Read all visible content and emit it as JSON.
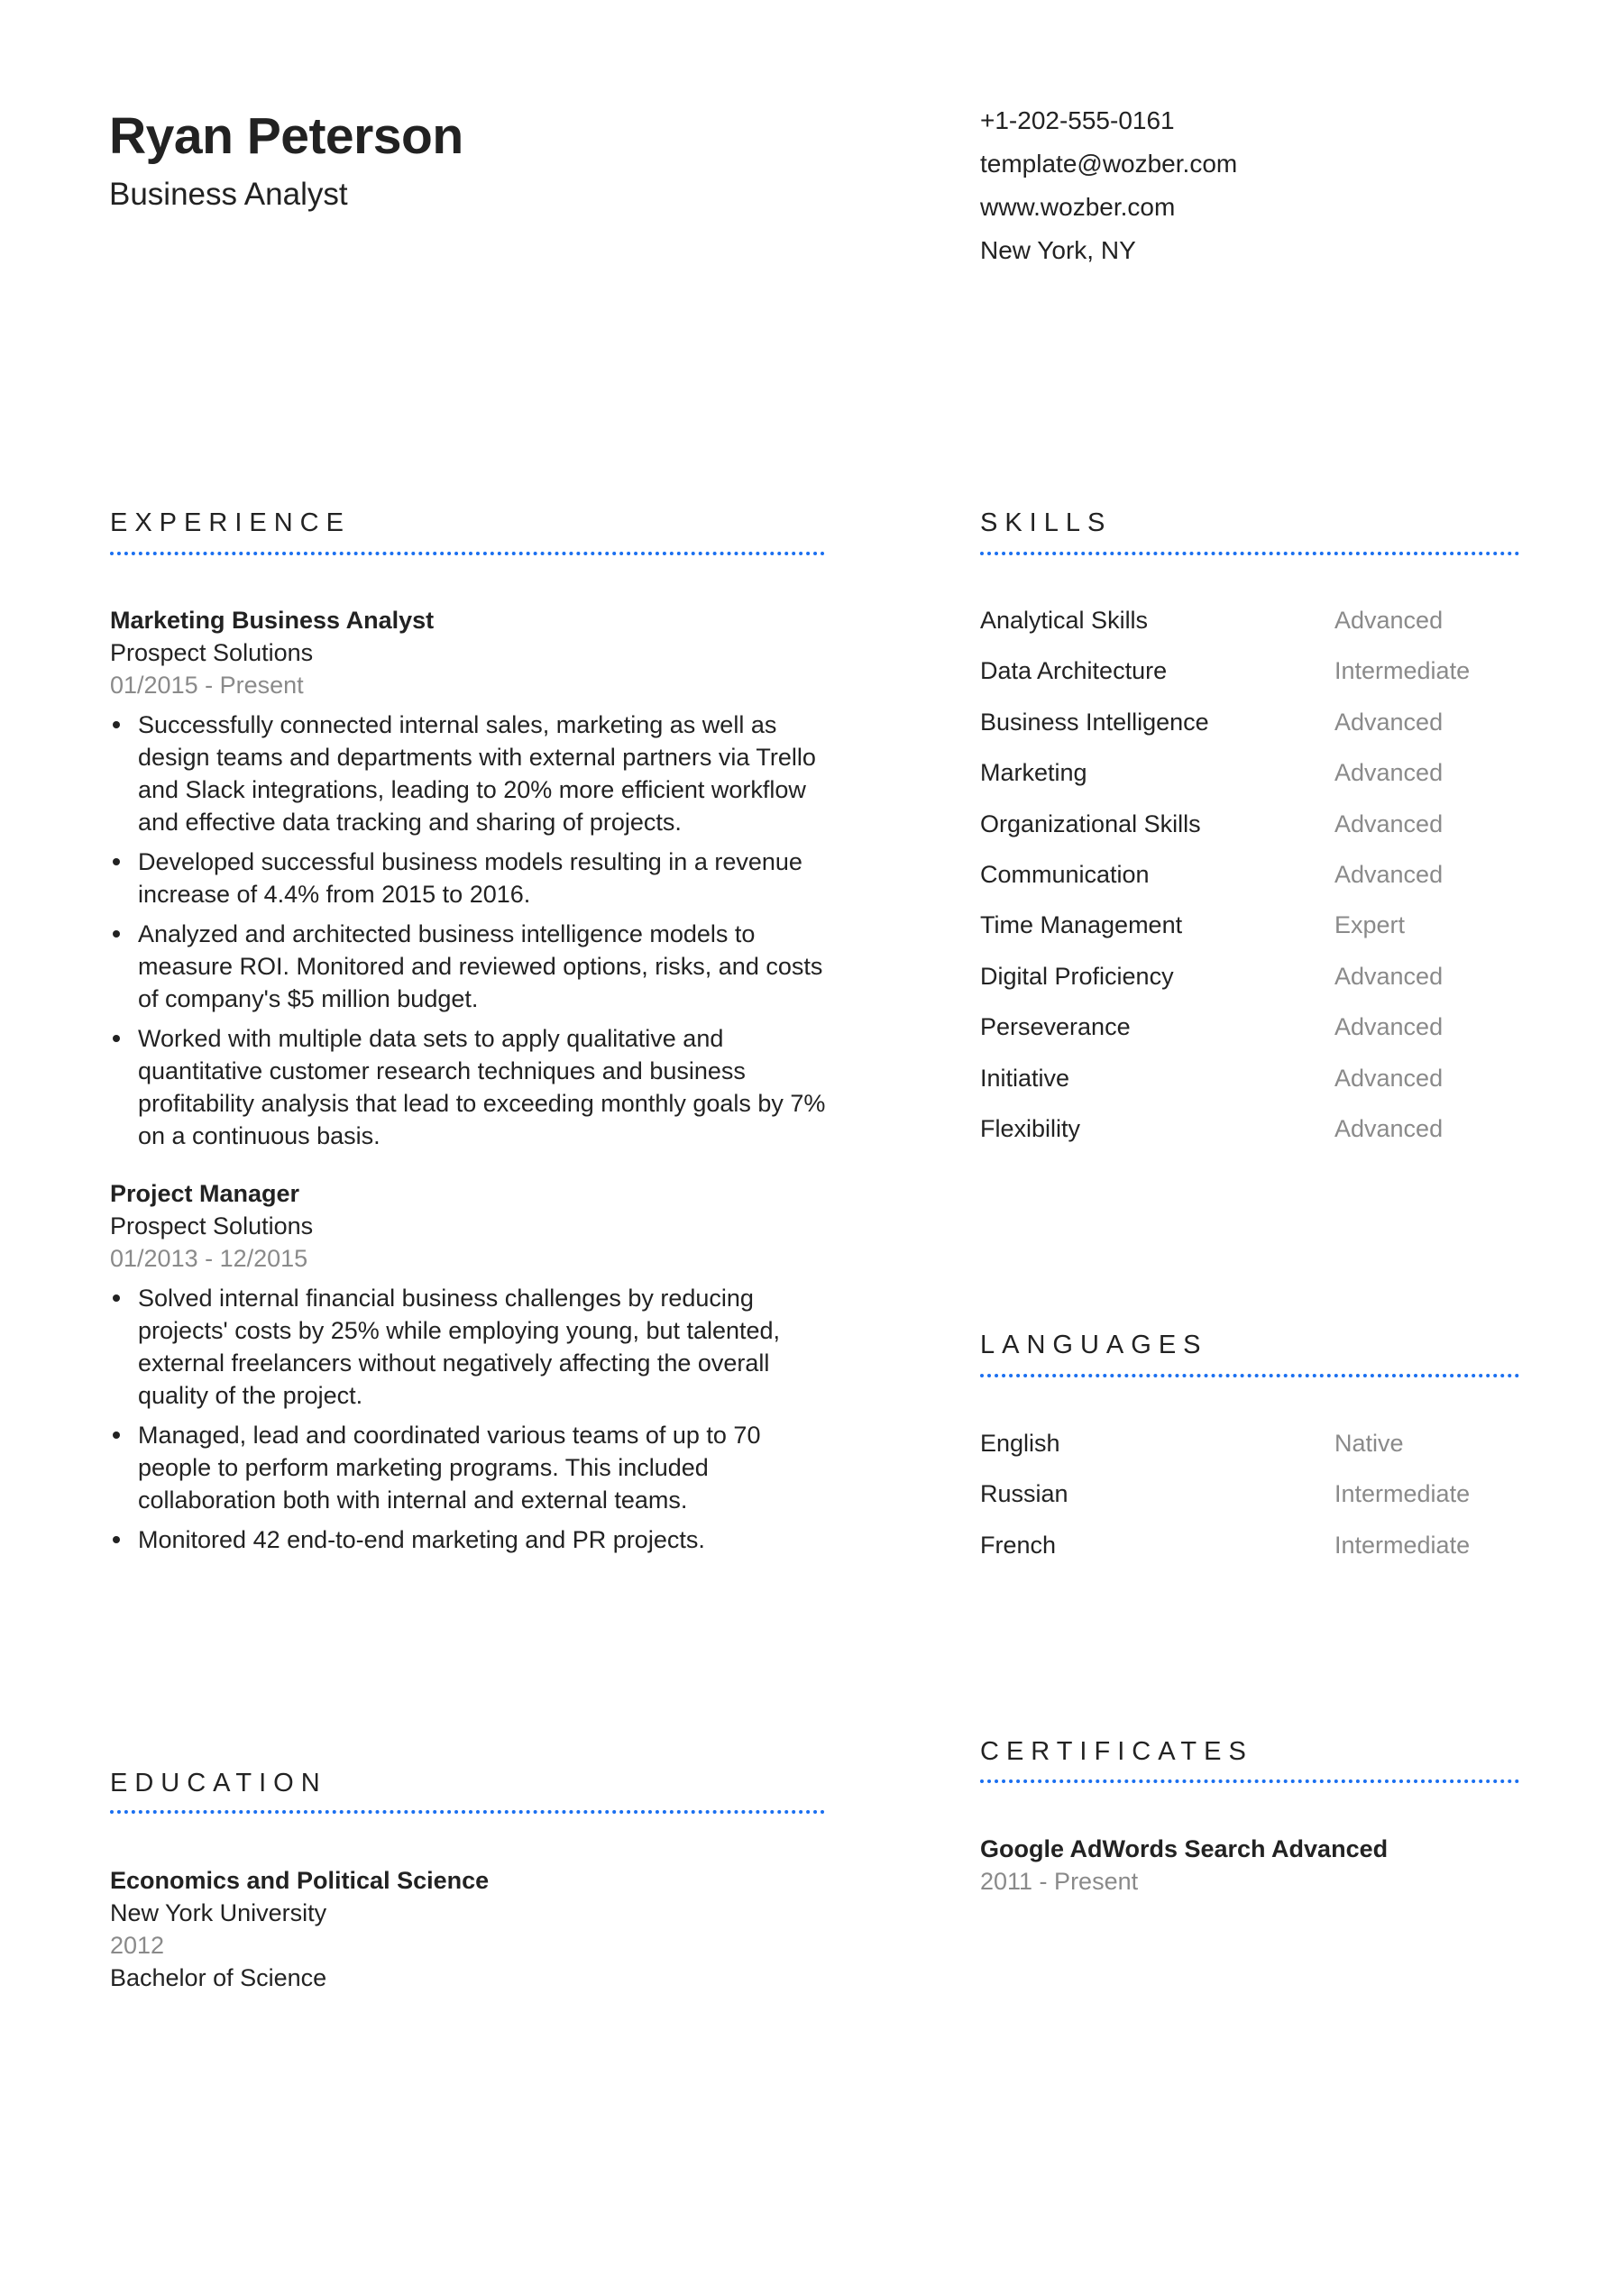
{
  "header": {
    "name": "Ryan Peterson",
    "title": "Business Analyst",
    "contact": {
      "phone": "+1-202-555-0161",
      "email": "template@wozber.com",
      "website": "www.wozber.com",
      "location": "New York, NY"
    }
  },
  "theme": {
    "accent_color": "#1a6ff0",
    "text_color": "#222222",
    "muted_color": "#8a8a8a"
  },
  "experience": {
    "heading": "EXPERIENCE",
    "jobs": [
      {
        "title": "Marketing Business Analyst",
        "company": "Prospect Solutions",
        "dates": "01/2015 - Present",
        "bullets": [
          "Successfully connected internal sales, marketing as well as design teams and departments with external partners via Trello and Slack integrations, leading to 20% more efficient workflow and effective data tracking and sharing of projects.",
          "Developed successful business models resulting in a revenue increase of 4.4% from 2015 to 2016.",
          "Analyzed and architected business intelligence models to measure ROI. Monitored and reviewed options, risks, and costs of company's $5 million budget.",
          "Worked with multiple data sets to apply qualitative and quantitative customer research techniques and business profitability analysis that lead to exceeding monthly goals by 7% on a continuous basis."
        ]
      },
      {
        "title": "Project Manager",
        "company": "Prospect Solutions",
        "dates": "01/2013 - 12/2015",
        "bullets": [
          "Solved internal financial business challenges by reducing projects' costs by 25% while employing young, but talented, external freelancers without negatively affecting the overall quality of the project.",
          "Managed, lead and coordinated various teams of up to 70 people to perform marketing programs. This included collaboration both with internal and external teams.",
          "Monitored 42 end-to-end marketing and PR projects."
        ]
      }
    ]
  },
  "skills": {
    "heading": "SKILLS",
    "items": [
      {
        "name": "Analytical Skills",
        "level": "Advanced"
      },
      {
        "name": "Data Architecture",
        "level": "Intermediate"
      },
      {
        "name": "Business Intelligence",
        "level": "Advanced"
      },
      {
        "name": "Marketing",
        "level": "Advanced"
      },
      {
        "name": "Organizational Skills",
        "level": "Advanced"
      },
      {
        "name": "Communication",
        "level": "Advanced"
      },
      {
        "name": "Time Management",
        "level": "Expert"
      },
      {
        "name": "Digital Proficiency",
        "level": "Advanced"
      },
      {
        "name": "Perseverance",
        "level": "Advanced"
      },
      {
        "name": "Initiative",
        "level": "Advanced"
      },
      {
        "name": "Flexibility",
        "level": "Advanced"
      }
    ]
  },
  "languages": {
    "heading": "LANGUAGES",
    "items": [
      {
        "name": "English",
        "level": "Native"
      },
      {
        "name": "Russian",
        "level": "Intermediate"
      },
      {
        "name": "French",
        "level": "Intermediate"
      }
    ]
  },
  "education": {
    "heading": "EDUCATION",
    "items": [
      {
        "field": "Economics and Political Science",
        "school": "New York University",
        "year": "2012",
        "degree": "Bachelor of Science"
      }
    ]
  },
  "certificates": {
    "heading": "CERTIFICATES",
    "items": [
      {
        "name": "Google AdWords Search Advanced",
        "dates": "2011 - Present"
      }
    ]
  }
}
